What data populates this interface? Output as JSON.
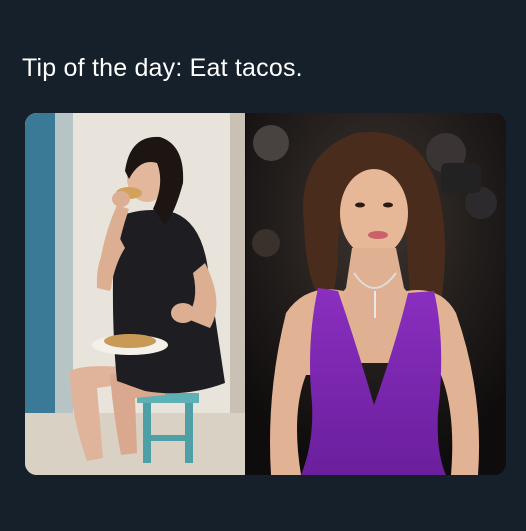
{
  "post": {
    "caption": "Tip of the day: Eat tacos."
  },
  "media": {
    "images": [
      {
        "name": "vintage-photo-eating-taco"
      },
      {
        "name": "red-carpet-photo-purple-dress"
      }
    ]
  }
}
